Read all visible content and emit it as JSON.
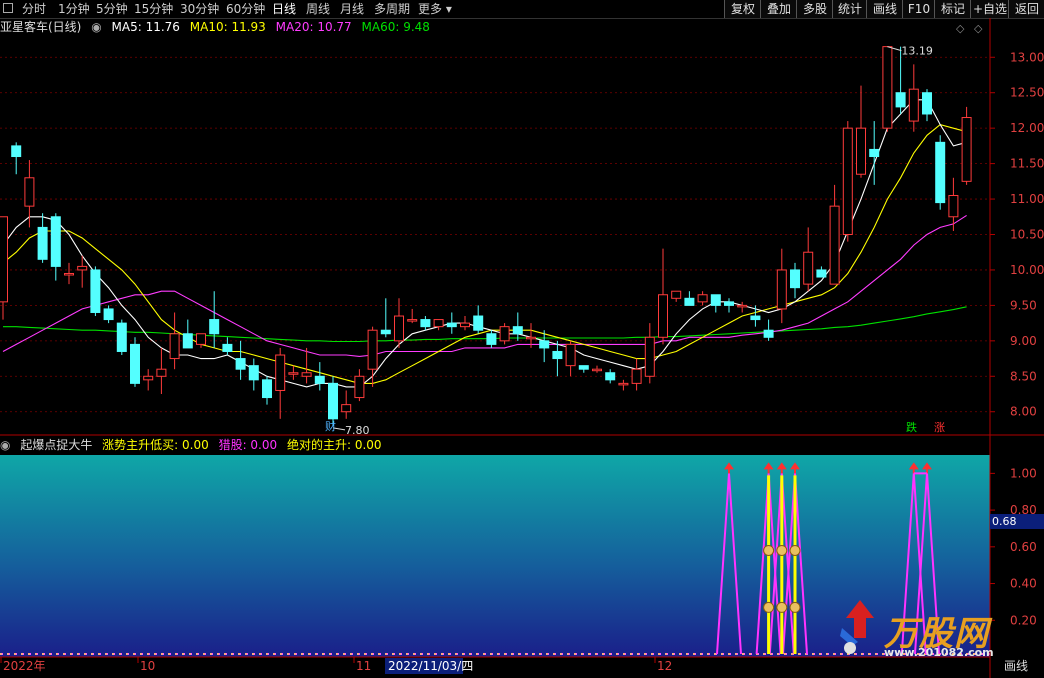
{
  "toolbar": {
    "left_icon": "square-icon",
    "periods": [
      "分时",
      "1分钟",
      "5分钟",
      "15分钟",
      "30分钟",
      "60分钟",
      "日线",
      "周线",
      "月线",
      "多周期",
      "更多"
    ],
    "active_period": "日线",
    "more_arrow": "▾",
    "right_buttons": [
      "复权",
      "叠加",
      "多股",
      "统计",
      "画线",
      "F10",
      "标记",
      "+自选",
      "返回"
    ]
  },
  "legend": {
    "stock": "亚星客车(日线)",
    "ma5": "MA5: 11.76",
    "ma10": "MA10: 11.93",
    "ma20": "MA20: 10.77",
    "ma60": "MA60: 9.48"
  },
  "annotations": {
    "high_label": "13.19",
    "low_label": "7.80",
    "finance_tag": "财",
    "fall_tag": "跌",
    "rise_tag": "涨"
  },
  "indicator_legend": {
    "name": "起爆点捉大牛",
    "item1": "涨势主升低买: 0.00",
    "item2": "猎股: 0.00",
    "item3": "绝对的主升: 0.00"
  },
  "indicator_scale": {
    "ticks": [
      "1.00",
      "0.80",
      "0.60",
      "0.40",
      "0.20"
    ],
    "highlight": "0.68"
  },
  "x_axis": {
    "labels": [
      "2022年",
      "10",
      "11",
      "2022/11/03/四",
      "12"
    ],
    "corner": "画线"
  },
  "watermark": {
    "brand": "万股网",
    "url": "www.201082.com"
  },
  "colors": {
    "up": "#ff3b3b",
    "down": "#54ffff",
    "ma5": "#ffffff",
    "ma10": "#ffff00",
    "ma20": "#ff3cff",
    "ma60": "#00e000",
    "axis": "#b00000"
  },
  "chart_data": [
    {
      "type": "candlestick",
      "title": "亚星客车(日线)",
      "ylim": [
        7.7,
        13.3
      ],
      "yticks": [
        8.0,
        8.5,
        9.0,
        9.5,
        10.0,
        10.5,
        11.0,
        11.5,
        12.0,
        12.5,
        13.0
      ],
      "grid": true,
      "candles": [
        [
          9.55,
          10.75,
          9.3,
          10.55
        ],
        [
          11.75,
          11.6,
          11.35,
          11.8
        ],
        [
          10.9,
          11.3,
          10.6,
          11.55
        ],
        [
          10.6,
          10.15,
          10.1,
          10.8
        ],
        [
          10.75,
          10.05,
          9.85,
          10.8
        ],
        [
          9.95,
          9.95,
          9.8,
          10.1
        ],
        [
          10.0,
          10.05,
          9.75,
          10.2
        ],
        [
          10.0,
          9.4,
          9.35,
          10.05
        ],
        [
          9.45,
          9.3,
          9.25,
          9.5
        ],
        [
          9.25,
          8.85,
          8.8,
          9.3
        ],
        [
          8.95,
          8.4,
          8.35,
          9.05
        ],
        [
          8.45,
          8.5,
          8.3,
          8.6
        ],
        [
          8.5,
          8.6,
          8.25,
          8.9
        ],
        [
          8.75,
          9.1,
          8.6,
          9.4
        ],
        [
          9.1,
          8.9,
          8.9,
          9.3
        ],
        [
          8.95,
          9.1,
          8.9,
          9.1
        ],
        [
          9.3,
          9.1,
          8.9,
          9.7
        ],
        [
          8.95,
          8.85,
          8.8,
          9.05
        ],
        [
          8.75,
          8.6,
          8.45,
          9.0
        ],
        [
          8.65,
          8.45,
          8.3,
          8.75
        ],
        [
          8.45,
          8.2,
          8.1,
          8.5
        ],
        [
          8.3,
          8.8,
          7.9,
          8.9
        ],
        [
          8.55,
          8.55,
          8.45,
          8.65
        ],
        [
          8.5,
          8.55,
          8.4,
          8.9
        ],
        [
          8.5,
          8.4,
          8.3,
          8.7
        ],
        [
          8.4,
          7.9,
          7.8,
          8.5
        ],
        [
          8.0,
          8.1,
          7.9,
          8.3
        ],
        [
          8.2,
          8.5,
          8.15,
          8.6
        ],
        [
          8.6,
          9.15,
          8.35,
          9.2
        ],
        [
          9.15,
          9.1,
          9.05,
          9.6
        ],
        [
          9.0,
          9.35,
          8.9,
          9.6
        ],
        [
          9.3,
          9.3,
          9.25,
          9.45
        ],
        [
          9.3,
          9.2,
          9.15,
          9.35
        ],
        [
          9.2,
          9.3,
          9.15,
          9.3
        ],
        [
          9.25,
          9.2,
          9.1,
          9.4
        ],
        [
          9.2,
          9.25,
          9.15,
          9.35
        ],
        [
          9.35,
          9.15,
          9.1,
          9.5
        ],
        [
          9.1,
          8.95,
          8.9,
          9.15
        ],
        [
          9.0,
          9.2,
          8.95,
          9.25
        ],
        [
          9.2,
          9.1,
          9.0,
          9.4
        ],
        [
          9.05,
          9.05,
          8.9,
          9.25
        ],
        [
          9.0,
          8.9,
          8.7,
          9.15
        ],
        [
          8.85,
          8.75,
          8.5,
          9.0
        ],
        [
          8.65,
          8.95,
          8.5,
          9.0
        ],
        [
          8.65,
          8.6,
          8.55,
          8.65
        ],
        [
          8.6,
          8.6,
          8.55,
          8.65
        ],
        [
          8.55,
          8.45,
          8.4,
          8.6
        ],
        [
          8.4,
          8.4,
          8.3,
          8.45
        ],
        [
          8.4,
          8.6,
          8.3,
          8.75
        ],
        [
          8.5,
          9.05,
          8.4,
          9.25
        ],
        [
          9.05,
          9.65,
          8.95,
          10.3
        ],
        [
          9.6,
          9.7,
          9.55,
          9.7
        ],
        [
          9.6,
          9.5,
          9.5,
          9.7
        ],
        [
          9.55,
          9.65,
          9.5,
          9.7
        ],
        [
          9.65,
          9.5,
          9.4,
          9.65
        ],
        [
          9.55,
          9.5,
          9.4,
          9.6
        ],
        [
          9.5,
          9.5,
          9.4,
          9.55
        ],
        [
          9.35,
          9.3,
          9.2,
          9.5
        ],
        [
          9.15,
          9.05,
          9.0,
          9.3
        ],
        [
          9.45,
          10.0,
          9.25,
          10.3
        ],
        [
          10.0,
          9.75,
          9.6,
          10.1
        ],
        [
          9.8,
          10.25,
          9.7,
          10.6
        ],
        [
          10.0,
          9.9,
          9.9,
          10.05
        ],
        [
          9.8,
          10.9,
          9.8,
          11.2
        ],
        [
          10.5,
          12.0,
          10.4,
          12.1
        ],
        [
          11.35,
          12.0,
          11.3,
          12.6
        ],
        [
          11.7,
          11.6,
          11.2,
          12.1
        ],
        [
          12.0,
          13.15,
          11.95,
          13.15
        ],
        [
          12.5,
          12.3,
          12.2,
          13.15
        ],
        [
          12.1,
          12.55,
          11.95,
          12.9
        ],
        [
          12.5,
          12.2,
          12.1,
          12.55
        ],
        [
          11.8,
          10.95,
          10.85,
          11.9
        ],
        [
          10.75,
          11.05,
          10.55,
          11.3
        ],
        [
          11.25,
          12.15,
          11.2,
          12.3
        ]
      ],
      "ma5": [
        10.35,
        10.6,
        10.75,
        10.75,
        10.7,
        10.5,
        10.2,
        9.95,
        9.75,
        9.5,
        9.3,
        9.05,
        8.9,
        8.8,
        8.8,
        8.75,
        8.75,
        8.8,
        8.7,
        8.6,
        8.5,
        8.45,
        8.4,
        8.35,
        8.4,
        8.4,
        8.35,
        8.35,
        8.5,
        8.75,
        8.95,
        9.1,
        9.15,
        9.2,
        9.25,
        9.25,
        9.2,
        9.15,
        9.1,
        9.1,
        9.05,
        9.0,
        8.95,
        8.9,
        8.8,
        8.75,
        8.7,
        8.65,
        8.6,
        8.65,
        8.85,
        9.1,
        9.3,
        9.45,
        9.55,
        9.55,
        9.5,
        9.45,
        9.4,
        9.45,
        9.55,
        9.7,
        9.85,
        10.1,
        10.55,
        11.0,
        11.5,
        12.0,
        12.2,
        12.4,
        12.4,
        12.05,
        11.75,
        11.8
      ],
      "ma10": [
        10.1,
        10.25,
        10.45,
        10.55,
        10.55,
        10.55,
        10.45,
        10.3,
        10.15,
        10.0,
        9.8,
        9.55,
        9.3,
        9.15,
        9.05,
        8.95,
        8.9,
        8.85,
        8.85,
        8.8,
        8.75,
        8.7,
        8.65,
        8.6,
        8.55,
        8.5,
        8.45,
        8.4,
        8.4,
        8.45,
        8.55,
        8.65,
        8.75,
        8.85,
        8.95,
        9.05,
        9.1,
        9.15,
        9.15,
        9.15,
        9.15,
        9.1,
        9.05,
        9.0,
        8.95,
        8.9,
        8.85,
        8.8,
        8.75,
        8.75,
        8.8,
        8.85,
        8.95,
        9.05,
        9.15,
        9.25,
        9.35,
        9.4,
        9.45,
        9.5,
        9.55,
        9.6,
        9.65,
        9.75,
        9.95,
        10.25,
        10.6,
        11.0,
        11.3,
        11.65,
        11.9,
        12.05,
        12.0,
        11.95
      ],
      "ma20": [
        8.85,
        8.95,
        9.05,
        9.15,
        9.25,
        9.35,
        9.45,
        9.5,
        9.55,
        9.6,
        9.65,
        9.65,
        9.7,
        9.7,
        9.6,
        9.5,
        9.4,
        9.3,
        9.2,
        9.1,
        9.0,
        8.95,
        8.9,
        8.85,
        8.8,
        8.8,
        8.8,
        8.78,
        8.8,
        8.85,
        8.85,
        8.85,
        8.85,
        8.85,
        8.85,
        8.9,
        8.9,
        8.9,
        8.9,
        8.95,
        8.95,
        8.95,
        8.95,
        8.95,
        8.95,
        8.95,
        8.95,
        8.95,
        8.95,
        8.95,
        9.0,
        9.0,
        9.05,
        9.05,
        9.05,
        9.05,
        9.08,
        9.1,
        9.12,
        9.15,
        9.2,
        9.25,
        9.35,
        9.45,
        9.55,
        9.7,
        9.85,
        10.0,
        10.15,
        10.35,
        10.5,
        10.6,
        10.65,
        10.77
      ],
      "ma60": [
        9.2,
        9.2,
        9.19,
        9.18,
        9.17,
        9.16,
        9.15,
        9.15,
        9.14,
        9.13,
        9.12,
        9.12,
        9.11,
        9.1,
        9.09,
        9.08,
        9.07,
        9.06,
        9.05,
        9.04,
        9.03,
        9.02,
        9.01,
        9.0,
        9.0,
        8.99,
        8.99,
        8.99,
        9.0,
        9.0,
        9.01,
        9.01,
        9.02,
        9.02,
        9.03,
        9.03,
        9.03,
        9.03,
        9.04,
        9.04,
        9.04,
        9.04,
        9.04,
        9.04,
        9.04,
        9.04,
        9.04,
        9.04,
        9.05,
        9.05,
        9.06,
        9.06,
        9.07,
        9.08,
        9.09,
        9.1,
        9.11,
        9.12,
        9.13,
        9.14,
        9.15,
        9.16,
        9.17,
        9.19,
        9.2,
        9.22,
        9.25,
        9.28,
        9.31,
        9.34,
        9.38,
        9.41,
        9.44,
        9.48
      ]
    },
    {
      "type": "area",
      "title": "起爆点捉大牛",
      "ylim": [
        0,
        1.1
      ],
      "yticks": [
        0.2,
        0.4,
        0.6,
        0.8,
        1.0
      ],
      "baseline_dashed": true,
      "signals": [
        {
          "series": "猎股",
          "color": "#ff33ff",
          "index": 55
        },
        {
          "series": "猎股",
          "color": "#ff33ff",
          "index": 58
        },
        {
          "series": "猎股",
          "color": "#ff33ff",
          "index": 59
        },
        {
          "series": "猎股",
          "color": "#ff33ff",
          "index": 60
        },
        {
          "series": "猎股",
          "color": "#ff33ff",
          "index": 69
        },
        {
          "series": "猎股",
          "color": "#ff33ff",
          "index": 70
        },
        {
          "series": "涨势主升低买",
          "color": "#ffff00",
          "index": 58
        },
        {
          "series": "涨势主升低买",
          "color": "#ffff00",
          "index": 59
        },
        {
          "series": "涨势主升低买",
          "color": "#ffff00",
          "index": 60
        }
      ]
    }
  ]
}
